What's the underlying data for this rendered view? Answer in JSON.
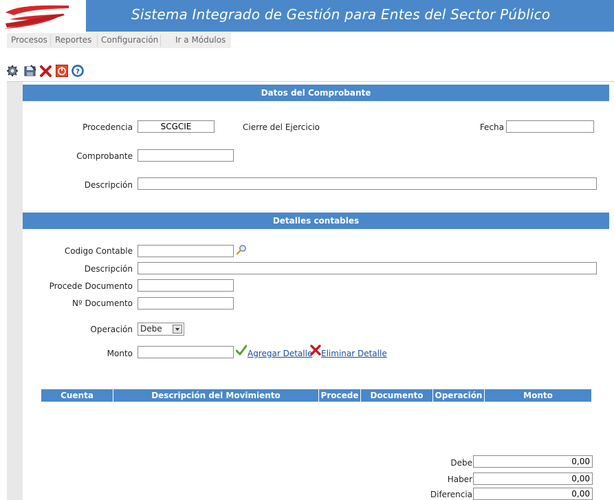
{
  "header": {
    "title": "Sistema Integrado de Gestión para Entes del Sector Público"
  },
  "menu": {
    "items": [
      "Procesos",
      "Reportes",
      "Configuración",
      "Ir a Módulos"
    ]
  },
  "toolbar": {
    "icons": [
      "new-icon",
      "save-icon",
      "delete-icon",
      "exit-icon",
      "help-icon"
    ]
  },
  "comprobante": {
    "section_title": "Datos del Comprobante",
    "procedencia_label": "Procedencia",
    "procedencia_value": "SCGCIE",
    "procedencia_desc": "Cierre del Ejercicio",
    "fecha_label": "Fecha",
    "fecha_value": "",
    "comprobante_label": "Comprobante",
    "comprobante_value": "",
    "descripcion_label": "Descripción",
    "descripcion_value": ""
  },
  "detalles": {
    "section_title": "Detalles contables",
    "codigo_label": "Codigo Contable",
    "codigo_value": "",
    "descripcion_label": "Descripción",
    "descripcion_value": "",
    "procede_label": "Procede Documento",
    "procede_value": "",
    "numero_label": "Nº Documento",
    "numero_value": "",
    "operacion_label": "Operación",
    "operacion_value": "Debe",
    "monto_label": "Monto",
    "monto_value": "",
    "agregar_label": "Agregar Detalle",
    "eliminar_label": "Eliminar Detalle"
  },
  "grid": {
    "columns": [
      "Cuenta",
      "Descripción del Movimiento",
      "Procede",
      "Documento",
      "Operación",
      "Monto"
    ]
  },
  "totals": {
    "debe_label": "Debe",
    "debe_value": "0,00",
    "haber_label": "Haber",
    "haber_value": "0,00",
    "diferencia_label": "Diferencia",
    "diferencia_value": "0,00"
  },
  "colors": {
    "accent": "#4a88c9",
    "logo_red": "#d7262a"
  }
}
